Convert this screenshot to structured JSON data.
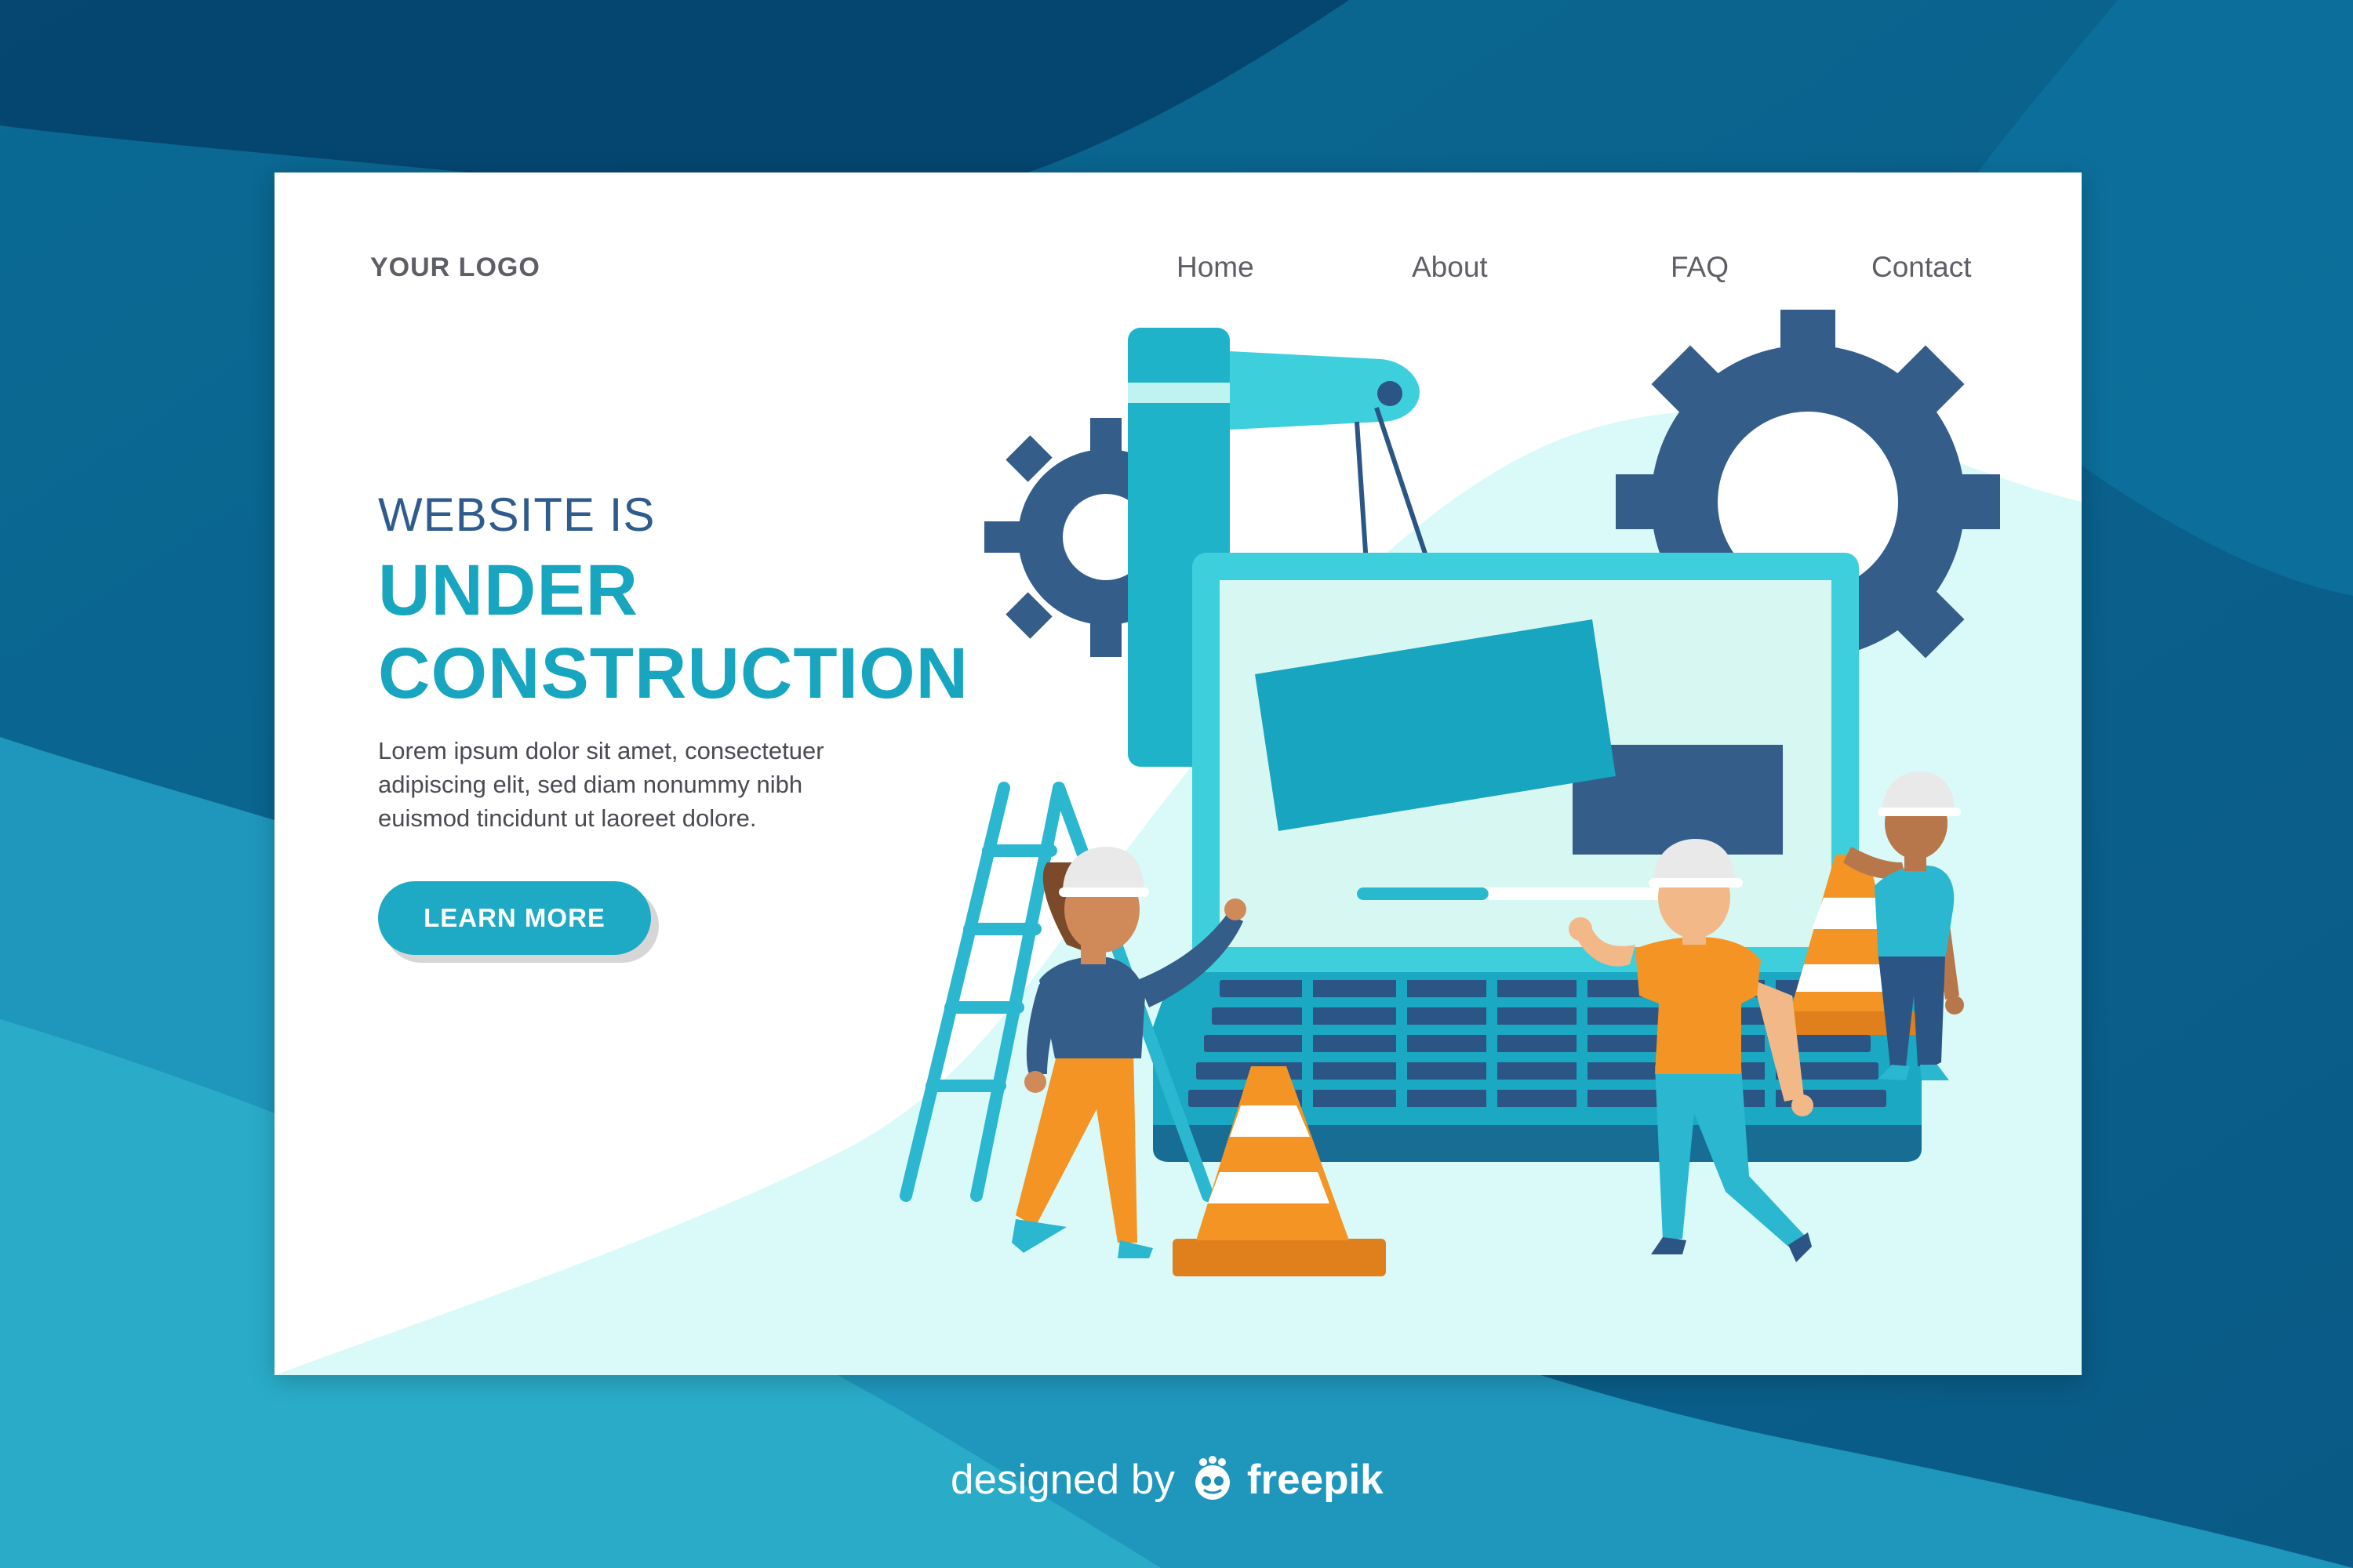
{
  "header": {
    "logo": "YOUR LOGO",
    "nav": [
      {
        "label": "Home"
      },
      {
        "label": "About"
      },
      {
        "label": "FAQ"
      },
      {
        "label": "Contact"
      }
    ]
  },
  "hero": {
    "eyebrow": "WEBSITE IS",
    "title_line1": "UNDER",
    "title_line2": "CONSTRUCTION",
    "body_lines": [
      "Lorem ipsum dolor sit amet, consectetuer",
      "adipiscing elit, sed diam nonummy nibh",
      "euismod tincidunt ut laoreet dolore."
    ],
    "cta_label": "LEARN MORE"
  },
  "illustration": {
    "loading_progress": 0.39
  },
  "footer": {
    "prefix": "designed by",
    "brand": "freepik",
    "brand_icon": "freepik-logo-icon"
  },
  "colors": {
    "background_dark": "#064a78",
    "background_light": "#2aa6c6",
    "accent": "#17a5bf",
    "navy": "#2f5c8c",
    "cone_orange": "#f39424"
  }
}
